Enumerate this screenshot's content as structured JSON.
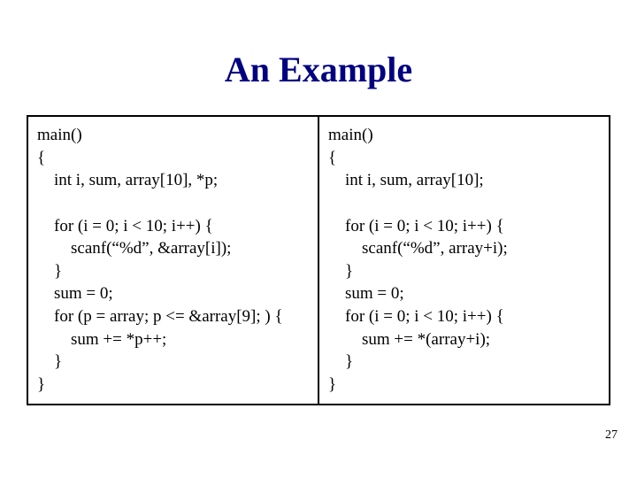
{
  "title": "An Example",
  "left": {
    "l1": "main()",
    "l2": "{",
    "l3": "    int i, sum, array[10], *p;",
    "l4": "",
    "l5": "    for (i = 0; i < 10; i++) {",
    "l6": "        scanf(“%d”, &array[i]);",
    "l7": "    }",
    "l8": "    sum = 0;",
    "l9": "    for (p = array; p <= &array[9]; ) {",
    "l10": "        sum += *p++;",
    "l11": "    }",
    "l12": "}"
  },
  "right": {
    "l1": "main()",
    "l2": "{",
    "l3": "    int i, sum, array[10];",
    "l4": "",
    "l5": "    for (i = 0; i < 10; i++) {",
    "l6": "        scanf(“%d”, array+i);",
    "l7": "    }",
    "l8": "    sum = 0;",
    "l9": "    for (i = 0; i < 10; i++) {",
    "l10": "        sum += *(array+i);",
    "l11": "    }",
    "l12": "}"
  },
  "page_number": "27"
}
